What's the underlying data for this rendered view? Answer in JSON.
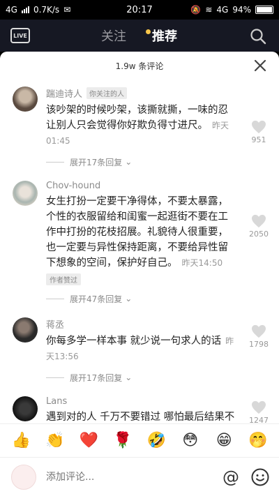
{
  "status_bar": {
    "network": "4G",
    "speed": "0.7K/s",
    "time": "20:17",
    "network_right": "4G",
    "battery": "94%"
  },
  "top_nav": {
    "live_label": "LIVE",
    "tabs": [
      {
        "label": "关注",
        "active": false
      },
      {
        "label": "推荐",
        "active": true
      }
    ]
  },
  "sheet": {
    "title": "1.9w 条评论",
    "comments": [
      {
        "user": "踹迪诗人",
        "badge": "你关注的人",
        "text": "该吵架的时候吵架，该撕就撕，一味的忍让别人只会觉得你好欺负得寸进尺。",
        "time": "昨天01:45",
        "author_tag": "",
        "expand": "展开17条回复",
        "likes": "951"
      },
      {
        "user": "Chov-hound",
        "badge": "",
        "text": "女生打扮一定要干净得体，不要太暴露，个性的衣服留给和闺蜜一起逛街不要在工作中打扮的花枝招展。礼貌待人很重要，也一定要与异性保持距离，不要给异性留下想象的空间，保护好自己。",
        "time": "昨天14:50",
        "author_tag": "作者赞过",
        "expand": "展开47条回复",
        "likes": "2050"
      },
      {
        "user": "蒋丞",
        "badge": "",
        "text": "你每多学一样本事 就少说一句求人的话",
        "time": "昨天13:56",
        "author_tag": "",
        "expand": "展开17条回复",
        "likes": "1798"
      },
      {
        "user": "Lans",
        "badge": "",
        "text": "遇到对的人 千万不要错过 哪怕最后结果不尽人意 但一定要用心对待 千万千万不要留下遗憾 如果已经失去了",
        "time": "",
        "author_tag": "",
        "expand": "",
        "likes": "1247"
      }
    ],
    "emojis": [
      "👍",
      "👏",
      "❤️",
      "🌹",
      "🤣",
      "😳",
      "😁",
      "🤭"
    ],
    "input_placeholder": "添加评论..."
  }
}
